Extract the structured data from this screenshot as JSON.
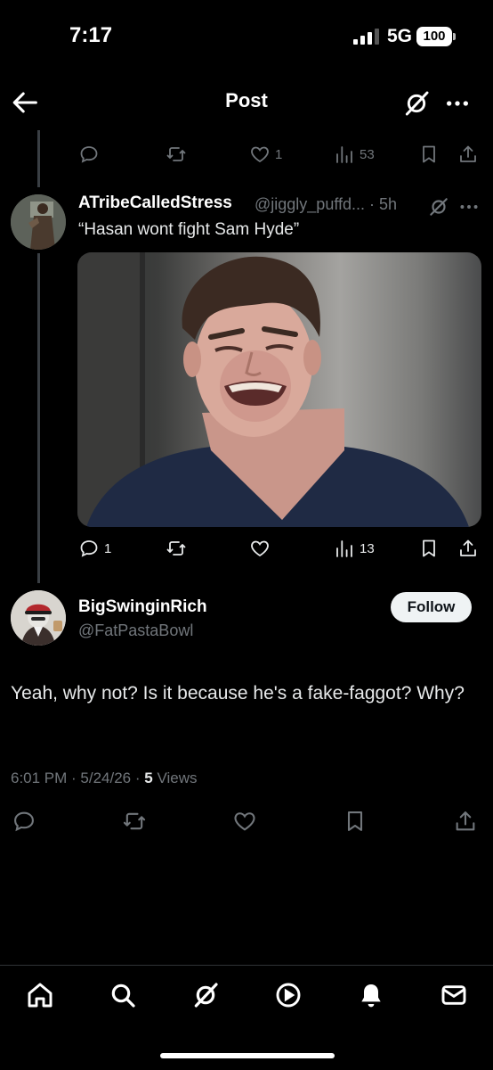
{
  "status_bar": {
    "time": "7:17",
    "network": "5G",
    "battery": "100"
  },
  "header": {
    "title": "Post"
  },
  "parent_actions": {
    "likes": "1",
    "views": "53"
  },
  "reply": {
    "display_name": "ATribeCalledStress",
    "handle_time": "@jiggly_puffd... · 5h",
    "text": "“Hasan wont fight Sam Hyde”",
    "replies": "1",
    "views": "13"
  },
  "main_post": {
    "display_name": "BigSwinginRich",
    "handle": "@FatPastaBowl",
    "follow_label": "Follow",
    "text": "Yeah, why not? Is it because he's a fake-faggot? Why?",
    "timestamp": "6:01 PM · 5/24/26 · ",
    "views_count": "5",
    "views_label": " Views"
  },
  "icons": {
    "back": "arrow-left-icon",
    "grok": "grok-icon",
    "more": "more-icon",
    "reply": "reply-icon",
    "repost": "repost-icon",
    "like": "heart-icon",
    "views": "views-icon",
    "bookmark": "bookmark-icon",
    "share": "share-icon",
    "home": "home-icon",
    "search": "search-icon",
    "video": "video-icon",
    "notifications": "bell-icon",
    "messages": "mail-icon"
  },
  "colors": {
    "background": "#000000",
    "text": "#e7e9ea",
    "secondary": "#71767b",
    "thread_line": "#3a3f44"
  }
}
